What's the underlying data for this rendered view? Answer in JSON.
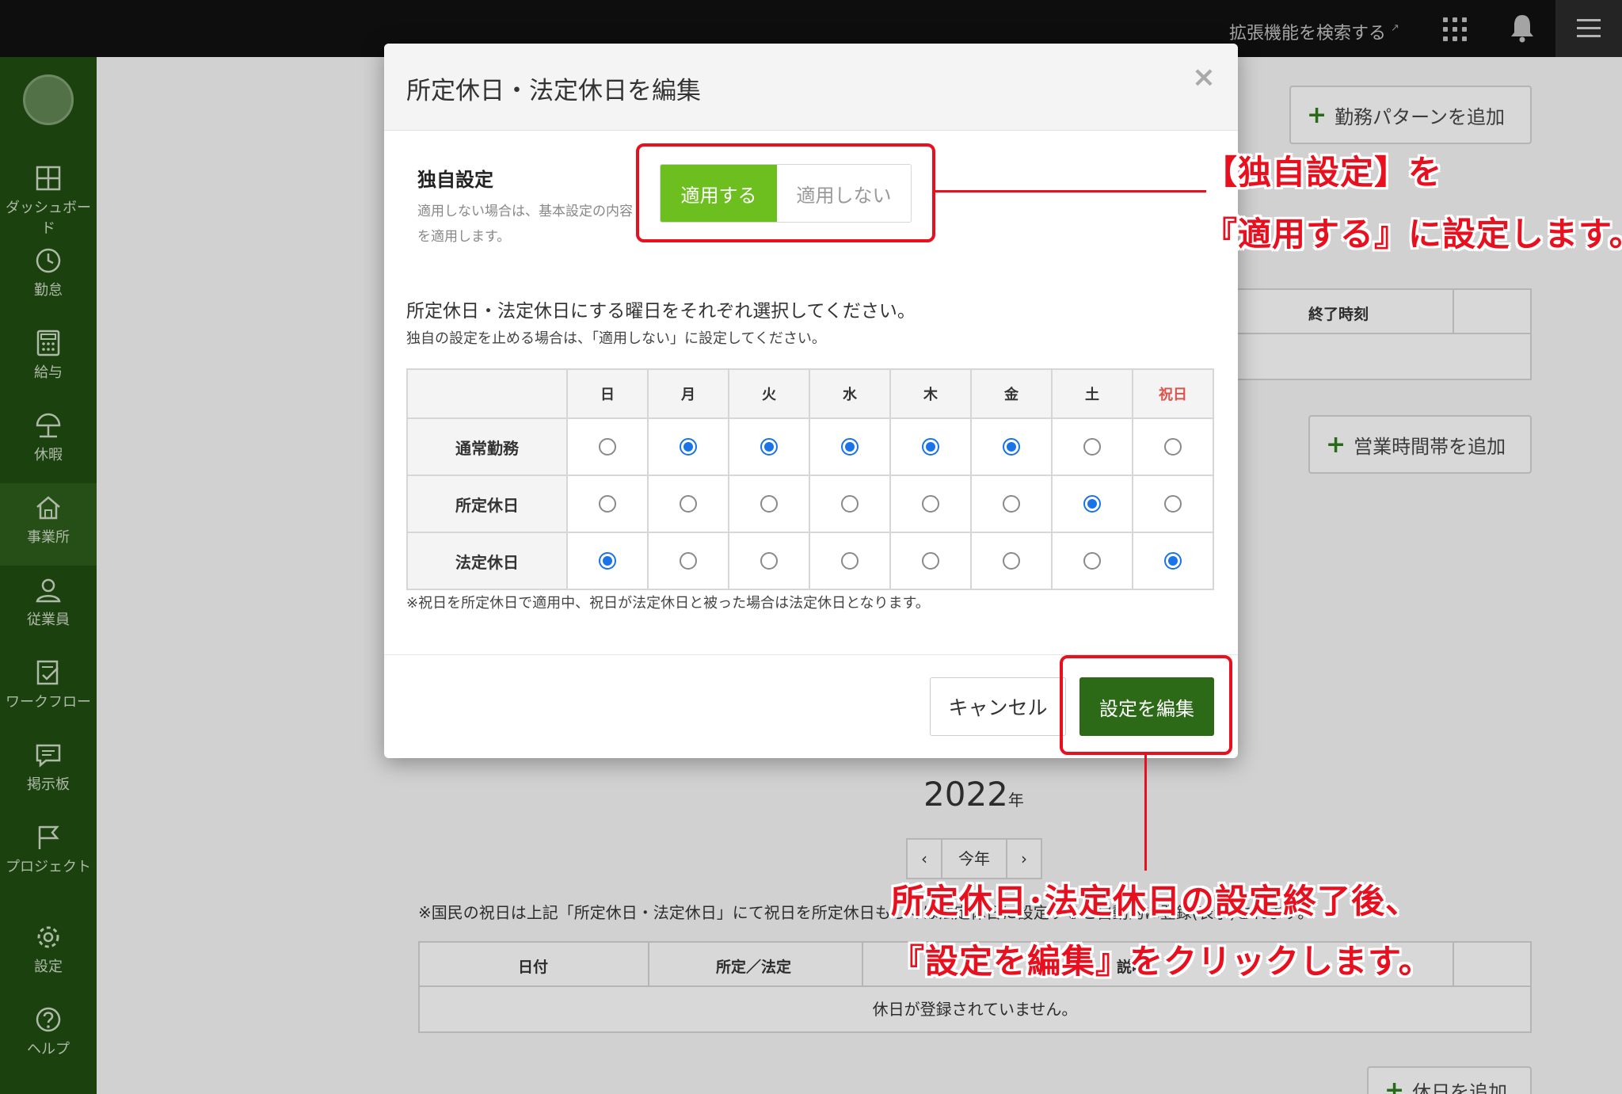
{
  "topbar": {
    "extension_search": "拡張機能を検索する"
  },
  "sidebar": {
    "items": [
      {
        "label": "ダッシュボード",
        "icon": "dashboard-icon"
      },
      {
        "label": "勤怠",
        "icon": "clock-icon"
      },
      {
        "label": "給与",
        "icon": "calculator-icon"
      },
      {
        "label": "休暇",
        "icon": "umbrella-icon"
      },
      {
        "label": "事業所",
        "icon": "home-icon"
      },
      {
        "label": "従業員",
        "icon": "person-icon"
      },
      {
        "label": "ワークフロー",
        "icon": "checklist-icon"
      },
      {
        "label": "掲示板",
        "icon": "message-icon"
      },
      {
        "label": "プロジェクト",
        "icon": "flag-icon"
      },
      {
        "label": "設定",
        "icon": "gear-icon"
      },
      {
        "label": "ヘルプ",
        "icon": "help-icon"
      }
    ],
    "active_index": 4
  },
  "background": {
    "add_pattern_button": "勤務パターンを追加",
    "end_time_header": "終了時刻",
    "add_hours_button": "営業時間帯を追加",
    "year_value": "2022",
    "year_unit": "年",
    "this_year": "今年",
    "prev": "‹",
    "next": "›",
    "holiday_note": "※国民の祝日は上記「所定休日・法定休日」にて祝日を所定休日もしくは法定休日に設定すると自動的に登録(表示)されます。",
    "holiday_table": {
      "headers": [
        "日付",
        "所定／法定",
        "説明"
      ],
      "empty": "休日が登録されていません。"
    },
    "add_holiday_button": "休日を追加"
  },
  "modal": {
    "title": "所定休日・法定休日を編集",
    "close": "×",
    "own_setting": {
      "label": "独自設定",
      "description": "適用しない場合は、基本設定の内容を適用します。",
      "apply": "適用する",
      "not_apply": "適用しない"
    },
    "instruction": "所定休日・法定休日にする曜日をそれぞれ選択してください。",
    "instruction_sub": "独自の設定を止める場合は、「適用しない」に設定してください。",
    "table": {
      "days": [
        "日",
        "月",
        "火",
        "水",
        "木",
        "金",
        "土",
        "祝日"
      ],
      "rows": [
        {
          "label": "通常勤務",
          "selected": [
            false,
            true,
            true,
            true,
            true,
            true,
            false,
            false
          ]
        },
        {
          "label": "所定休日",
          "selected": [
            false,
            false,
            false,
            false,
            false,
            false,
            true,
            false
          ]
        },
        {
          "label": "法定休日",
          "selected": [
            true,
            false,
            false,
            false,
            false,
            false,
            false,
            true
          ]
        }
      ]
    },
    "note": "※祝日を所定休日で適用中、祝日が法定休日と被った場合は法定休日となります。",
    "cancel": "キャンセル",
    "submit": "設定を編集"
  },
  "annotations": {
    "callout1_line1": "【独自設定】を",
    "callout1_line2": "『適用する』に設定します。",
    "callout2_line1": "所定休日･法定休日の設定終了後、",
    "callout2_line2": "『設定を編集』をクリックします。"
  },
  "colors": {
    "accent_green": "#6cbf1f",
    "dark_green": "#2d6a17",
    "sidebar_green": "#1f4a12",
    "radio_blue": "#1a73e8",
    "annotation_red": "#e8101f",
    "holiday_red": "#d9534f"
  }
}
